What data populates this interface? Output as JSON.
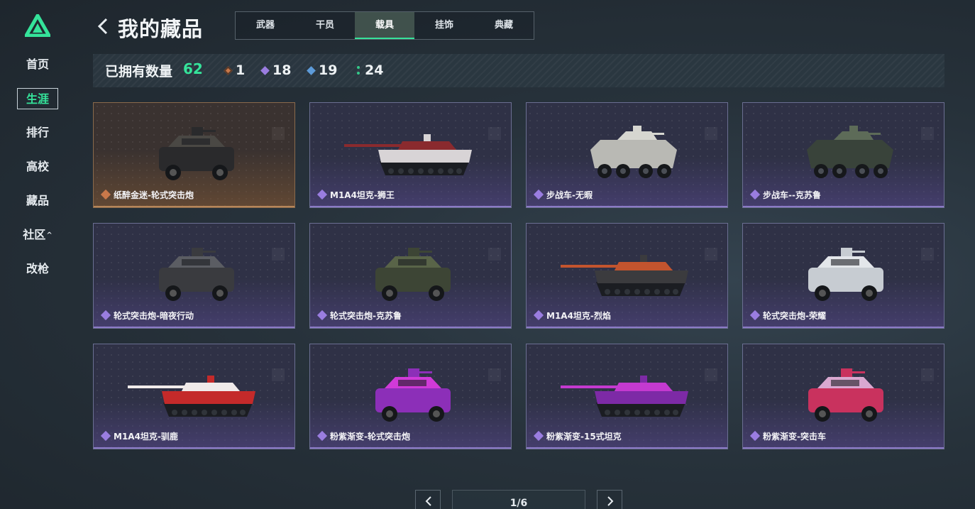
{
  "sidebar": {
    "items": [
      {
        "label": "首页",
        "active": false
      },
      {
        "label": "生涯",
        "active": true
      },
      {
        "label": "排行",
        "active": false
      },
      {
        "label": "高校",
        "active": false
      },
      {
        "label": "藏品",
        "active": false
      },
      {
        "label": "社区",
        "active": false,
        "caret": "^"
      },
      {
        "label": "改枪",
        "active": false
      }
    ]
  },
  "header": {
    "title": "我的藏品",
    "tabs": [
      {
        "label": "武器",
        "active": false
      },
      {
        "label": "干员",
        "active": false
      },
      {
        "label": "载具",
        "active": true
      },
      {
        "label": "挂饰",
        "active": false
      },
      {
        "label": "典藏",
        "active": false
      }
    ]
  },
  "summary": {
    "label": "已拥有数量",
    "total": "62",
    "rarities": [
      {
        "count": "1",
        "color": "#c9784a",
        "icon": "orange-diamond-icon"
      },
      {
        "count": "18",
        "color": "#9a7de0",
        "icon": "purple-diamond-icon"
      },
      {
        "count": "19",
        "color": "#5d9bd9",
        "icon": "blue-diamond-icon"
      },
      {
        "count": "24",
        "color": "#35c98a",
        "icon": "green-dots-icon"
      }
    ]
  },
  "colors": {
    "accent": "#35e39a",
    "legendary": "#c9784a",
    "epic": "#9a7de0"
  },
  "cards": [
    {
      "name": "纸醉金迷-轮式突击炮",
      "rarity": "orange",
      "vehicle": "armored-car"
    },
    {
      "name": "M1A4坦克-狮王",
      "rarity": "purple",
      "vehicle": "tank"
    },
    {
      "name": "步战车-无暇",
      "rarity": "purple",
      "vehicle": "ifv"
    },
    {
      "name": "步战车--克苏鲁",
      "rarity": "purple",
      "vehicle": "ifv"
    },
    {
      "name": "轮式突击炮-暗夜行动",
      "rarity": "purple",
      "vehicle": "armored-car"
    },
    {
      "name": "轮式突击炮-克苏鲁",
      "rarity": "purple",
      "vehicle": "armored-car"
    },
    {
      "name": "M1A4坦克-烈焰",
      "rarity": "purple",
      "vehicle": "tank"
    },
    {
      "name": "轮式突击炮-荣耀",
      "rarity": "purple",
      "vehicle": "armored-car"
    },
    {
      "name": "M1A4坦克-驯鹿",
      "rarity": "purple",
      "vehicle": "tank"
    },
    {
      "name": "粉紫渐变-轮式突击炮",
      "rarity": "purple",
      "vehicle": "armored-car"
    },
    {
      "name": "粉紫渐变-15式坦克",
      "rarity": "purple",
      "vehicle": "tank"
    },
    {
      "name": "粉紫渐变-突击车",
      "rarity": "purple",
      "vehicle": "armored-car"
    }
  ],
  "pagination": {
    "display": "1/6"
  }
}
